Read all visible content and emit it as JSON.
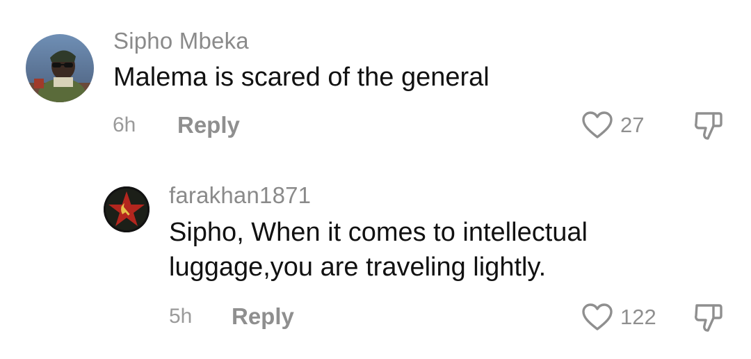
{
  "comments": [
    {
      "username": "Sipho Mbeka",
      "text": "Malema is scared of the general",
      "time": "6h",
      "reply_label": "Reply",
      "likes": "27",
      "avatar_icon": "user-photo-avatar"
    },
    {
      "username": "farakhan1871",
      "text_line1": "Sipho, When it comes to intellectual",
      "text_line2": "luggage,you are traveling lightly.",
      "time": "5h",
      "reply_label": "Reply",
      "likes": "122",
      "avatar_icon": "hammer-sickle-star-avatar"
    }
  ],
  "colors": {
    "text_primary": "#111111",
    "text_secondary": "#8a8a8a",
    "icon_gray": "#8f8f8f",
    "star_red": "#b3261e"
  }
}
